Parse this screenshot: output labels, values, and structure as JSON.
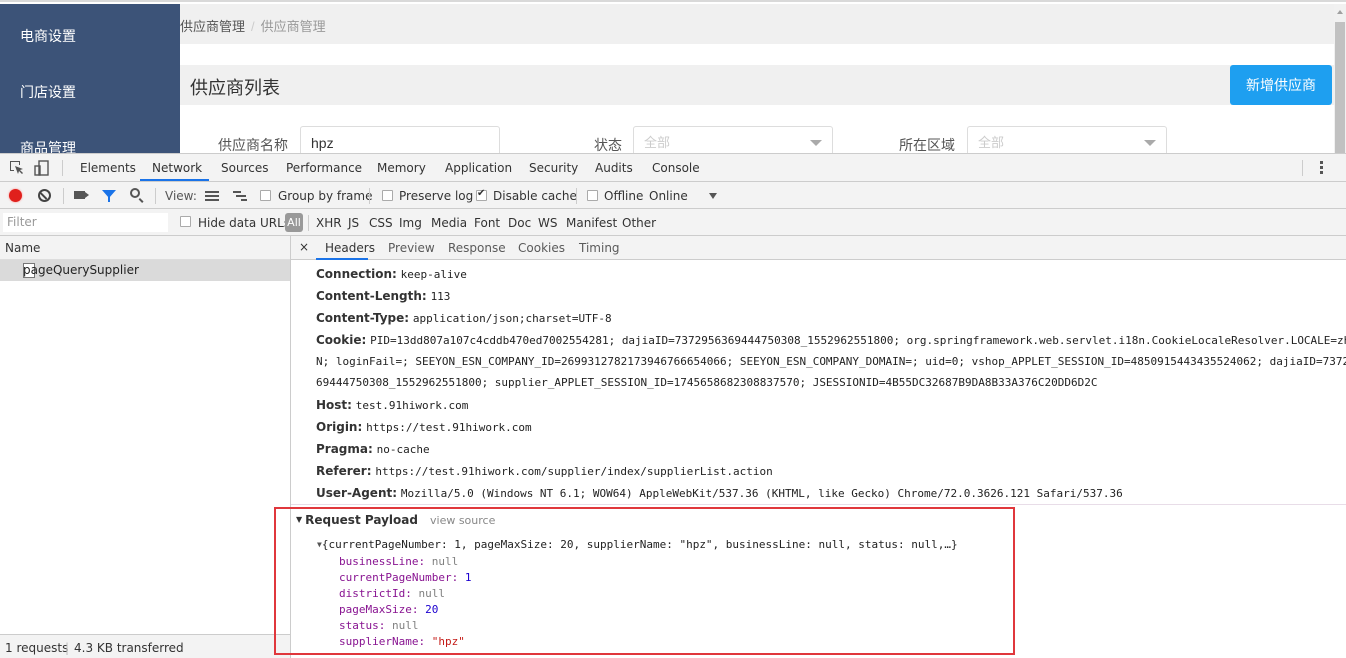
{
  "app": {
    "sidebar": {
      "items": [
        {
          "label": "电商设置"
        },
        {
          "label": "门店设置"
        },
        {
          "label": "商品管理"
        }
      ]
    },
    "breadcrumb": {
      "parent": "供应商管理",
      "separator": "/",
      "current": "供应商管理"
    },
    "page_title": "供应商列表",
    "add_button": "新增供应商",
    "filters": {
      "supplier_name": {
        "label": "供应商名称",
        "value": "hpz"
      },
      "status": {
        "label": "状态",
        "selected": "全部"
      },
      "region": {
        "label": "所在区域",
        "selected": "全部"
      }
    }
  },
  "devtools": {
    "tabs": [
      {
        "label": "Elements"
      },
      {
        "label": "Network",
        "active": true
      },
      {
        "label": "Sources"
      },
      {
        "label": "Performance"
      },
      {
        "label": "Memory"
      },
      {
        "label": "Application"
      },
      {
        "label": "Security"
      },
      {
        "label": "Audits"
      },
      {
        "label": "Console"
      }
    ],
    "toolbar": {
      "view_label": "View:",
      "group_by_frame": {
        "label": "Group by frame",
        "checked": false
      },
      "preserve_log": {
        "label": "Preserve log",
        "checked": false
      },
      "disable_cache": {
        "label": "Disable cache",
        "checked": true
      },
      "offline": {
        "label": "Offline",
        "checked": false
      },
      "throttling": "Online"
    },
    "filterbar": {
      "filter_placeholder": "Filter",
      "hide_data_urls": {
        "label": "Hide data URLs",
        "checked": false
      },
      "types": [
        "All",
        "XHR",
        "JS",
        "CSS",
        "Img",
        "Media",
        "Font",
        "Doc",
        "WS",
        "Manifest",
        "Other"
      ]
    },
    "request_list": {
      "header": "Name",
      "requests": [
        {
          "name": "pageQuerySupplier"
        }
      ],
      "status": {
        "requests": "1 requests",
        "transferred": "4.3 KB transferred"
      }
    },
    "detail": {
      "close": "×",
      "tabs": [
        {
          "label": "Headers",
          "active": true
        },
        {
          "label": "Preview"
        },
        {
          "label": "Response"
        },
        {
          "label": "Cookies"
        },
        {
          "label": "Timing"
        }
      ],
      "headers": [
        {
          "key": "Connection:",
          "value": "keep-alive"
        },
        {
          "key": "Content-Length:",
          "value": "113"
        },
        {
          "key": "Content-Type:",
          "value": "application/json;charset=UTF-8"
        },
        {
          "key": "Cookie:",
          "value": "PID=13dd807a107c4cddb470ed7002554281; dajiaID=7372956369444750308_1552962551800; org.springframework.web.servlet.i18n.CookieLocaleResolver.LOCALE=zh_"
        },
        {
          "key": "Host:",
          "value": "test.91hiwork.com"
        },
        {
          "key": "Origin:",
          "value": "https://test.91hiwork.com"
        },
        {
          "key": "Pragma:",
          "value": "no-cache"
        },
        {
          "key": "Referer:",
          "value": "https://test.91hiwork.com/supplier/index/supplierList.action"
        },
        {
          "key": "User-Agent:",
          "value": "Mozilla/5.0 (Windows NT 6.1; WOW64) AppleWebKit/537.36 (KHTML, like Gecko) Chrome/72.0.3626.121 Safari/537.36"
        }
      ],
      "cookie_continuation": [
        "N; loginFail=; SEEYON_ESN_COMPANY_ID=2699312782173946766654066; SEEYON_ESN_COMPANY_DOMAIN=; uid=0; vshop_APPLET_SESSION_ID=4850915443435524062; dajiaID=73729",
        "69444750308_1552962551800; supplier_APPLET_SESSION_ID=1745658682308837570; JSESSIONID=4B55DC32687B9DA8B33A376C20DD6D2C"
      ],
      "payload": {
        "title": "Request Payload",
        "view_source": "view source",
        "summary": "{currentPageNumber: 1, pageMaxSize: 20, supplierName: \"hpz\", businessLine: null, status: null,…}",
        "properties": [
          {
            "key": "businessLine",
            "value": "null",
            "type": "null"
          },
          {
            "key": "currentPageNumber",
            "value": "1",
            "type": "num"
          },
          {
            "key": "districtId",
            "value": "null",
            "type": "null"
          },
          {
            "key": "pageMaxSize",
            "value": "20",
            "type": "num"
          },
          {
            "key": "status",
            "value": "null",
            "type": "null"
          },
          {
            "key": "supplierName",
            "value": "\"hpz\"",
            "type": "str"
          }
        ]
      }
    }
  },
  "colors": {
    "sidebar_bg": "#3c5378",
    "primary_button": "#1e9ff0",
    "highlight_box": "#e0373c",
    "devtools_accent": "#1a73e8"
  }
}
